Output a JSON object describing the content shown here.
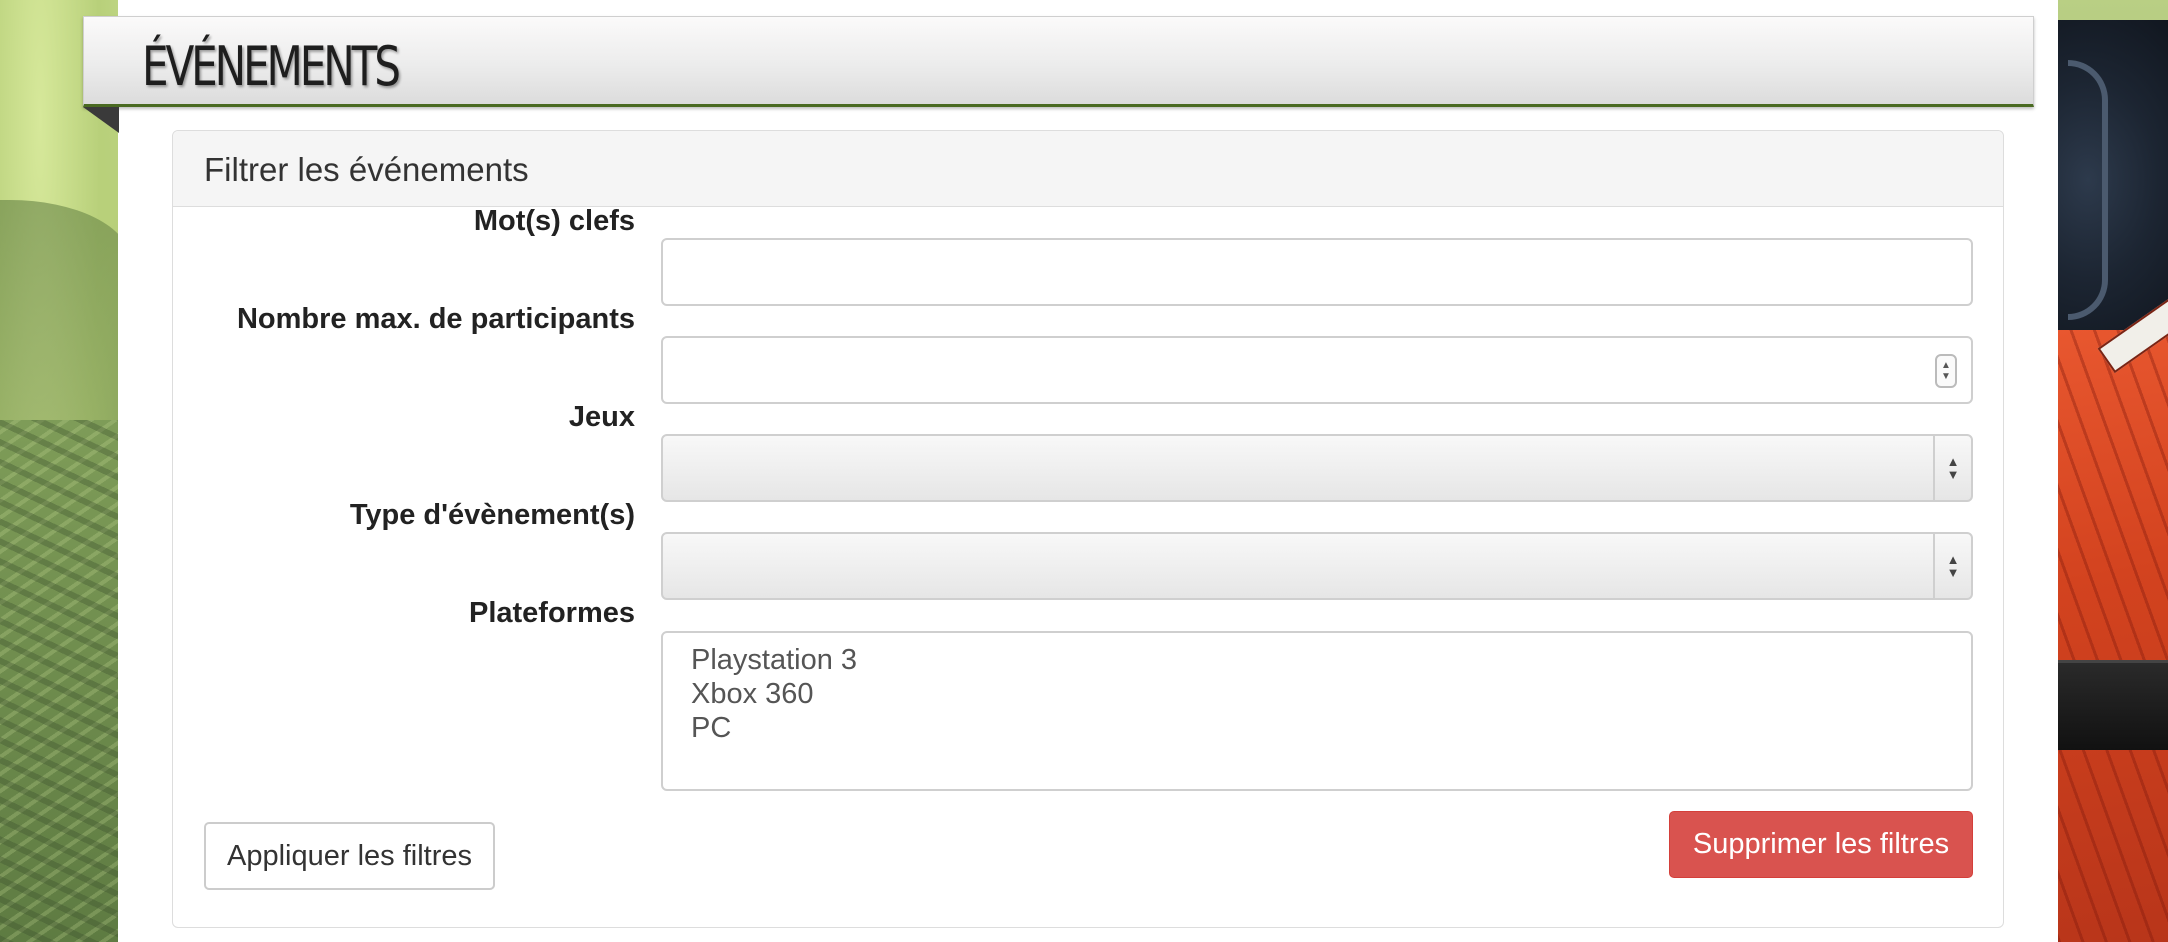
{
  "header": {
    "title": "ÉVÉNEMENTS"
  },
  "filter": {
    "title": "Filtrer les événements",
    "fields": {
      "keywords": {
        "label": "Mot(s) clefs",
        "value": ""
      },
      "max_participants": {
        "label": "Nombre max. de participants",
        "value": ""
      },
      "games": {
        "label": "Jeux",
        "selected": ""
      },
      "event_type": {
        "label": "Type d'évènement(s)",
        "selected": ""
      },
      "platforms": {
        "label": "Plateformes",
        "options": [
          "Playstation 3",
          "Xbox 360",
          "PC"
        ]
      }
    },
    "apply_label": "Appliquer les filtres",
    "clear_label": "Supprimer les filtres"
  },
  "colors": {
    "accent_green": "#4a6a22",
    "danger": "#d9534f"
  },
  "icons": {
    "select_arrows": "updown-arrows-icon",
    "spinner": "number-spinner-icon"
  }
}
